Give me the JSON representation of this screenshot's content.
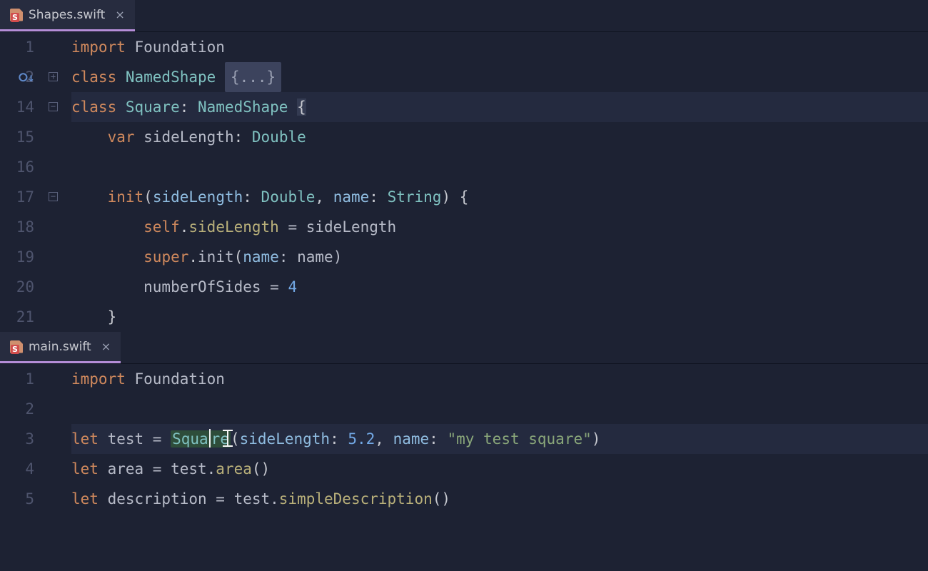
{
  "panes": [
    {
      "tab": {
        "filename": "Shapes.swift",
        "active": true
      },
      "lines": [
        {
          "num": "1",
          "tokens": [
            {
              "t": "import ",
              "c": "kw"
            },
            {
              "t": "Foundation",
              "c": "ident"
            }
          ]
        },
        {
          "num": "2",
          "gutter_icon": "override-down",
          "fold": "plus",
          "tokens": [
            {
              "t": "class ",
              "c": "kw"
            },
            {
              "t": "NamedShape ",
              "c": "type"
            },
            {
              "t": "{...}",
              "c": "fold-pill"
            }
          ]
        },
        {
          "num": "14",
          "fold": "minus",
          "hl": true,
          "tokens": [
            {
              "t": "class ",
              "c": "kw"
            },
            {
              "t": "Square",
              "c": "type"
            },
            {
              "t": ": ",
              "c": "punct"
            },
            {
              "t": "NamedShape ",
              "c": "type"
            },
            {
              "t": "{",
              "c": "punct caret-hl"
            }
          ]
        },
        {
          "num": "15",
          "tokens": [
            {
              "t": "    ",
              "c": ""
            },
            {
              "t": "var ",
              "c": "kw"
            },
            {
              "t": "sideLength",
              "c": "ident"
            },
            {
              "t": ": ",
              "c": "punct"
            },
            {
              "t": "Double",
              "c": "type"
            }
          ]
        },
        {
          "num": "16",
          "tokens": [
            {
              "t": " ",
              "c": ""
            }
          ]
        },
        {
          "num": "17",
          "fold": "minus",
          "tokens": [
            {
              "t": "    ",
              "c": ""
            },
            {
              "t": "init",
              "c": "kw"
            },
            {
              "t": "(",
              "c": "punct"
            },
            {
              "t": "sideLength",
              "c": "param"
            },
            {
              "t": ": ",
              "c": "punct"
            },
            {
              "t": "Double",
              "c": "type"
            },
            {
              "t": ", ",
              "c": "punct"
            },
            {
              "t": "name",
              "c": "param"
            },
            {
              "t": ": ",
              "c": "punct"
            },
            {
              "t": "String",
              "c": "type"
            },
            {
              "t": ") {",
              "c": "punct"
            }
          ]
        },
        {
          "num": "18",
          "tokens": [
            {
              "t": "        ",
              "c": ""
            },
            {
              "t": "self",
              "c": "kw"
            },
            {
              "t": ".",
              "c": "punct"
            },
            {
              "t": "sideLength",
              "c": "meth"
            },
            {
              "t": " = sideLength",
              "c": "ident"
            }
          ]
        },
        {
          "num": "19",
          "tokens": [
            {
              "t": "        ",
              "c": ""
            },
            {
              "t": "super",
              "c": "kw"
            },
            {
              "t": ".",
              "c": "punct"
            },
            {
              "t": "init",
              "c": "ident"
            },
            {
              "t": "(",
              "c": "punct"
            },
            {
              "t": "name",
              "c": "param"
            },
            {
              "t": ": name)",
              "c": "ident"
            }
          ]
        },
        {
          "num": "20",
          "tokens": [
            {
              "t": "        numberOfSides = ",
              "c": "ident"
            },
            {
              "t": "4",
              "c": "lit"
            }
          ]
        },
        {
          "num": "21",
          "fold": "end",
          "tokens": [
            {
              "t": "    }",
              "c": "punct"
            }
          ]
        }
      ]
    },
    {
      "tab": {
        "filename": "main.swift",
        "active": true
      },
      "lines": [
        {
          "num": "1",
          "tokens": [
            {
              "t": "import ",
              "c": "kw"
            },
            {
              "t": "Foundation",
              "c": "ident"
            }
          ]
        },
        {
          "num": "2",
          "tokens": [
            {
              "t": " ",
              "c": ""
            }
          ]
        },
        {
          "num": "3",
          "hl": true,
          "cursor": true,
          "tokens": [
            {
              "t": "let ",
              "c": "kw"
            },
            {
              "t": "test = ",
              "c": "ident"
            },
            {
              "t": "Square",
              "c": "type goto-hl",
              "cursor_after": 4
            },
            {
              "t": "(",
              "c": "punct"
            },
            {
              "t": "sideLength",
              "c": "param"
            },
            {
              "t": ": ",
              "c": "punct"
            },
            {
              "t": "5.2",
              "c": "lit"
            },
            {
              "t": ", ",
              "c": "punct"
            },
            {
              "t": "name",
              "c": "param"
            },
            {
              "t": ": ",
              "c": "punct"
            },
            {
              "t": "\"my test square\"",
              "c": "str"
            },
            {
              "t": ")",
              "c": "punct"
            }
          ]
        },
        {
          "num": "4",
          "tokens": [
            {
              "t": "let ",
              "c": "kw"
            },
            {
              "t": "area = test.",
              "c": "ident"
            },
            {
              "t": "area",
              "c": "meth"
            },
            {
              "t": "()",
              "c": "punct"
            }
          ]
        },
        {
          "num": "5",
          "tokens": [
            {
              "t": "let ",
              "c": "kw"
            },
            {
              "t": "description = test.",
              "c": "ident"
            },
            {
              "t": "simpleDescription",
              "c": "meth"
            },
            {
              "t": "()",
              "c": "punct"
            }
          ]
        }
      ]
    }
  ]
}
